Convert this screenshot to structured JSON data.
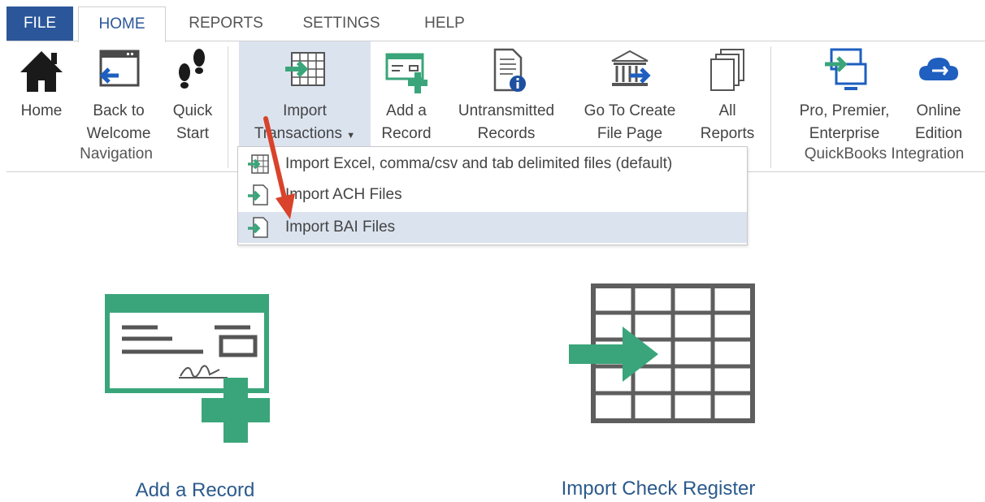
{
  "tabs": [
    "FILE",
    "HOME",
    "REPORTS",
    "SETTINGS",
    "HELP"
  ],
  "ribbon": {
    "navigation": {
      "home": "Home",
      "back_line1": "Back to",
      "back_line2": "Welcome",
      "quick_line1": "Quick",
      "quick_line2": "Start",
      "group_label": "Navigation"
    },
    "import_line1": "Import",
    "import_line2": "Transactions",
    "add_line1": "Add a",
    "add_line2": "Record",
    "untrans_line1": "Untransmitted",
    "untrans_line2": "Records",
    "goto_line1": "Go To Create",
    "goto_line2": "File Page",
    "all_line1": "All",
    "all_line2": "Reports",
    "pro_line1": "Pro, Premier,",
    "pro_line2": "Enterprise",
    "online_line1": "Online",
    "online_line2": "Edition",
    "qb_group_label": "QuickBooks Integration"
  },
  "dropdown": {
    "items": [
      "Import Excel, comma/csv and tab delimited files (default)",
      "Import ACH Files",
      "Import BAI Files"
    ]
  },
  "main": {
    "add_record": "Add a Record",
    "import_register": "Import Check Register"
  },
  "colors": {
    "accent_blue": "#2b579a",
    "green": "#3aa57a",
    "highlight": "#dbe3ef",
    "arrow_red": "#d9432b"
  }
}
